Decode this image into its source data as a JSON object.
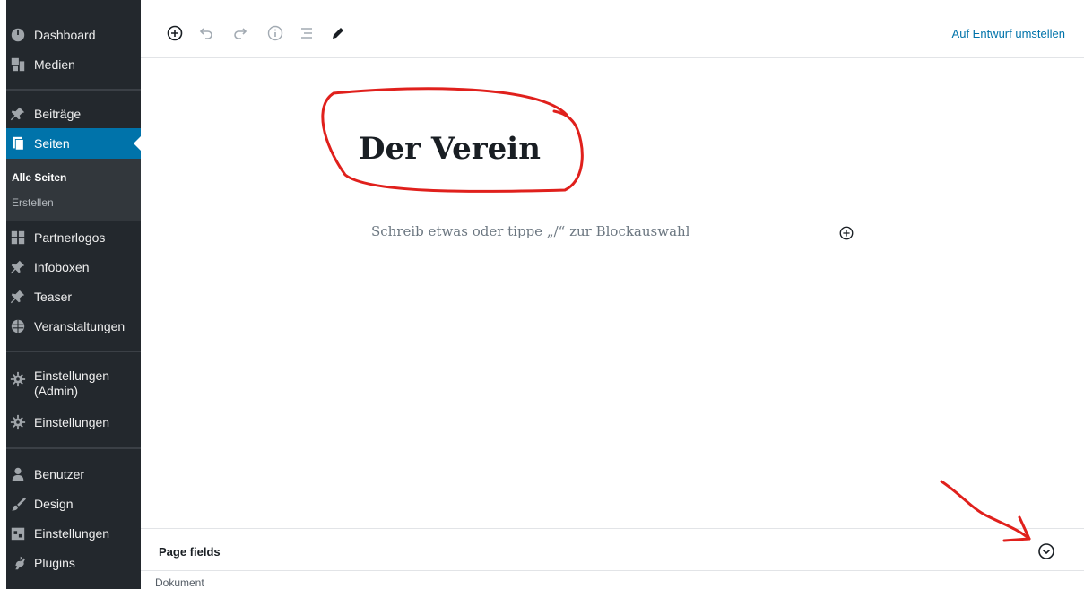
{
  "sidebar": {
    "items": [
      {
        "label": "Dashboard",
        "icon": "dashboard-icon"
      },
      {
        "label": "Medien",
        "icon": "media-icon"
      },
      {
        "label": "Beiträge",
        "icon": "pin-icon"
      },
      {
        "label": "Seiten",
        "icon": "pages-icon",
        "active": true
      },
      {
        "label": "Partnerlogos",
        "icon": "grid-icon"
      },
      {
        "label": "Infoboxen",
        "icon": "pin-icon"
      },
      {
        "label": "Teaser",
        "icon": "pin-icon"
      },
      {
        "label": "Veranstaltungen",
        "icon": "globe-icon"
      },
      {
        "label": "Einstellungen (Admin)",
        "icon": "gear-icon"
      },
      {
        "label": "Einstellungen",
        "icon": "gear-icon"
      },
      {
        "label": "Benutzer",
        "icon": "user-icon"
      },
      {
        "label": "Design",
        "icon": "brush-icon"
      },
      {
        "label": "Einstellungen",
        "icon": "settings-calendar-icon"
      },
      {
        "label": "Plugins",
        "icon": "plug-icon"
      }
    ],
    "submenu": [
      {
        "label": "Alle Seiten",
        "current": true
      },
      {
        "label": "Erstellen"
      }
    ]
  },
  "toolbar": {
    "tools": [
      "add-block-icon",
      "undo-icon",
      "redo-icon",
      "info-icon",
      "outline-icon",
      "edit-icon"
    ],
    "publish_link": "Auf Entwurf umstellen"
  },
  "editor": {
    "title": "Der Verein",
    "placeholder": "Schreib etwas oder tippe „/“ zur Blockauswahl"
  },
  "page_fields": {
    "title": "Page fields"
  },
  "footer": {
    "breadcrumb": "Dokument"
  },
  "colors": {
    "sidebar_bg": "#23282d",
    "active_bg": "#0073aa",
    "accent": "#0073aa",
    "annotation_red": "#e0201c"
  }
}
